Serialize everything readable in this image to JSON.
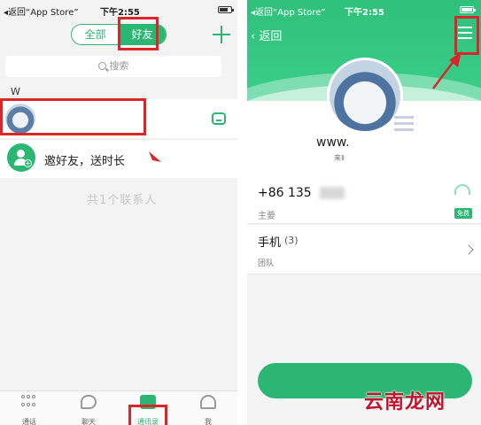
{
  "left": {
    "status": {
      "back_app": "◂返回“App Store”",
      "time": "下午2:55"
    },
    "segment": {
      "all_label": "全部",
      "friends_label": "好友"
    },
    "search": {
      "placeholder": "搜索"
    },
    "section_header": "W",
    "invite": {
      "label": "邀好友，送时长"
    },
    "total": "共1个联系人",
    "tabs": [
      {
        "label": "通话",
        "icon": "dialpad-icon"
      },
      {
        "label": "聊天",
        "icon": "chat-icon"
      },
      {
        "label": "通讯录",
        "icon": "contacts-icon",
        "active": true
      },
      {
        "label": "我",
        "icon": "me-icon"
      }
    ]
  },
  "right": {
    "status": {
      "back_app": "◂返回“App Store”",
      "time": "下午2:55"
    },
    "back_label": "‹ 返回",
    "profile": {
      "name": "www.",
      "subname": "来Ⅱ"
    },
    "phone": {
      "number": "+86 135",
      "type": "主要",
      "badge": "免费"
    },
    "mobile": {
      "label": "手机",
      "count": "(3)",
      "team": "团队"
    }
  },
  "watermark": "云南龙网",
  "colors": {
    "accent": "#2bb673",
    "highlight": "#d8262b"
  }
}
